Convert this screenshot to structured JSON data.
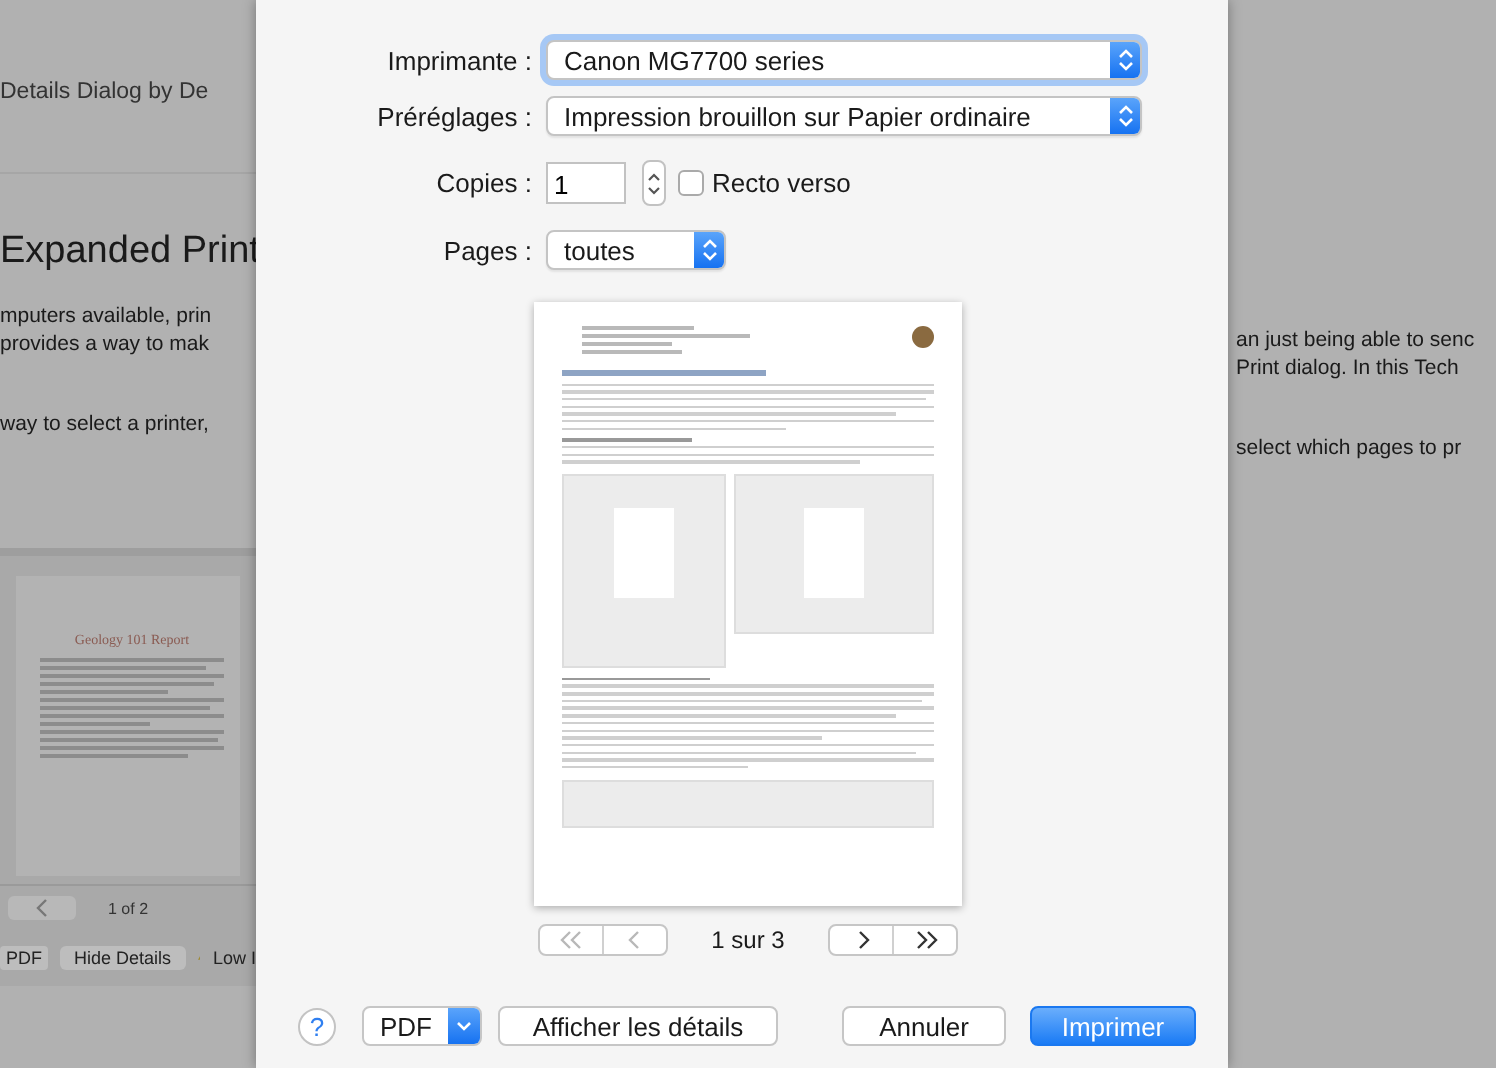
{
  "background_window": {
    "left": {
      "title": "Details Dialog by De",
      "heading": "Expanded Print",
      "paragraph_1": [
        "mputers available, prin",
        "provides a way to mak"
      ],
      "paragraph_2": "way to select a printer,",
      "preview_title": "Geology 101 Report",
      "page_indicator": "1 of 2",
      "pdf_button": "PDF",
      "hide_details_button": "Hide Details",
      "warning_text": "Low I"
    },
    "right": {
      "paragraph_1": [
        "an just being able to senc",
        "Print dialog. In this Tech"
      ],
      "paragraph_2": "select which pages to pr"
    }
  },
  "print_dialog": {
    "fields": [
      {
        "label": "Imprimante :",
        "kind": "popup",
        "value": "Canon MG7700 series",
        "focused": true
      },
      {
        "label": "Préréglages :",
        "kind": "popup",
        "value": "Impression brouillon sur Papier ordinaire",
        "focused": false
      },
      {
        "label": "Copies :",
        "kind": "copies",
        "value": "1",
        "duplex": {
          "label": "Recto verso",
          "checked": false
        }
      },
      {
        "label": "Pages :",
        "kind": "compact-popup",
        "value": "toutes",
        "focused": false
      }
    ],
    "nav_buttons": [
      {
        "kind": "first",
        "disabled": true
      },
      {
        "kind": "previous",
        "disabled": true
      },
      {
        "kind": "next",
        "disabled": false
      },
      {
        "kind": "last",
        "disabled": false
      }
    ],
    "page_counter": "1 sur 3",
    "help_button": "?",
    "pdf_button": "PDF",
    "details_button": "Afficher les détails",
    "cancel_button": "Annuler",
    "print_button": "Imprimer"
  }
}
